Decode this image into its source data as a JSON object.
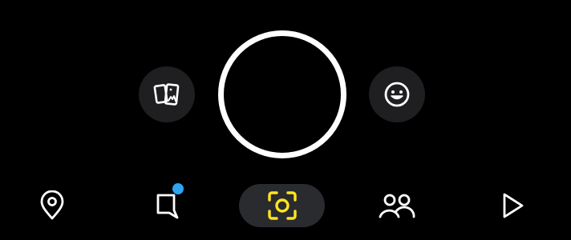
{
  "camera": {
    "memories_button": {
      "icon": "memories-cards-icon",
      "label": ""
    },
    "shutter_button": {
      "label": ""
    },
    "lenses_button": {
      "icon": "smiley-face-icon",
      "label": ""
    }
  },
  "nav": {
    "items": [
      {
        "id": "map",
        "icon": "location-pin-icon",
        "label": "",
        "active": false
      },
      {
        "id": "chat",
        "icon": "chat-bubble-icon",
        "label": "",
        "active": false,
        "has_badge": true
      },
      {
        "id": "camera",
        "icon": "camera-scan-icon",
        "label": "",
        "active": true
      },
      {
        "id": "stories",
        "icon": "friends-icon",
        "label": "",
        "active": false
      },
      {
        "id": "spotlight",
        "icon": "play-triangle-icon",
        "label": "",
        "active": false
      }
    ]
  },
  "colors": {
    "background": "#000000",
    "button_fill": "#1f1f21",
    "active_tab_fill": "#2a2b2e",
    "icon": "#ffffff",
    "active_icon": "#ffe51f",
    "badge": "#2ea4f2"
  }
}
